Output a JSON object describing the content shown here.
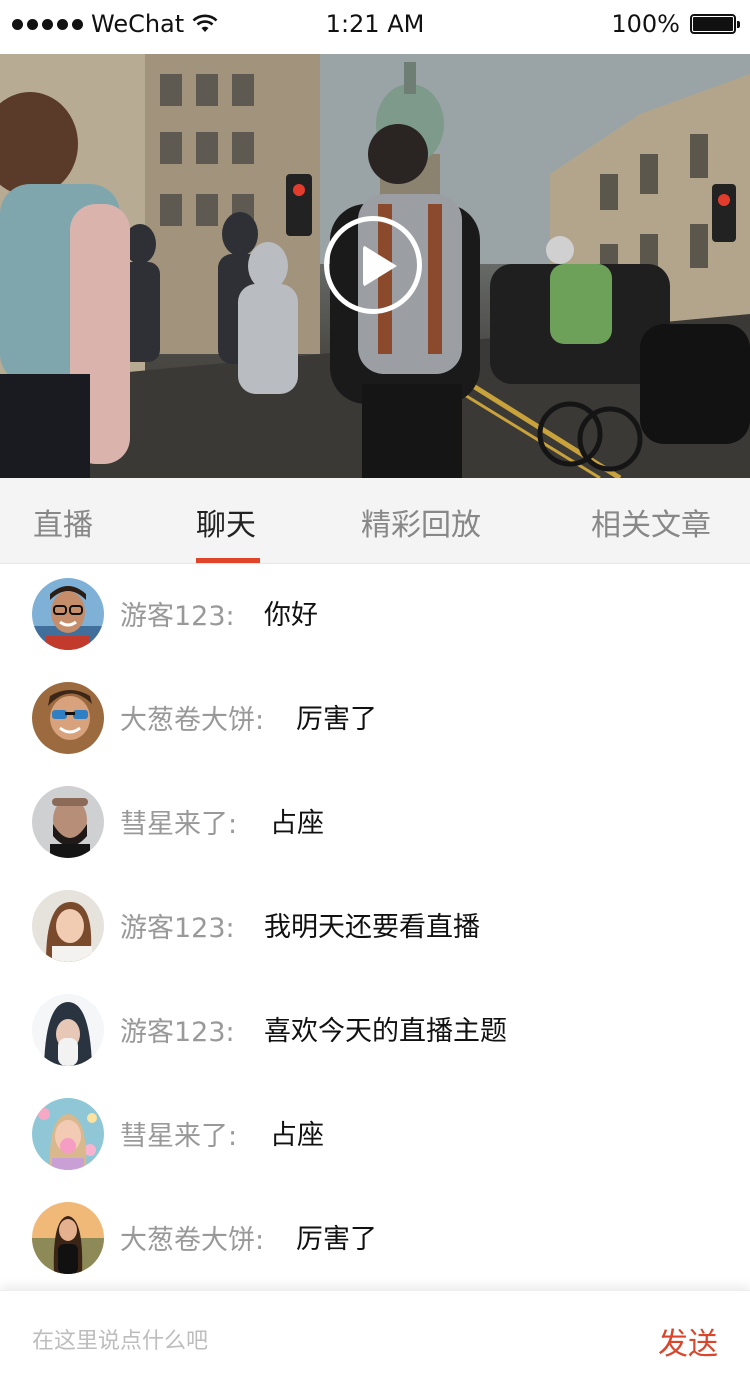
{
  "status_bar": {
    "carrier": "WeChat",
    "time": "1:21 AM",
    "battery": "100%"
  },
  "video": {
    "play_icon": "play-icon"
  },
  "tabs": [
    {
      "label": "直播",
      "active": false
    },
    {
      "label": "聊天",
      "active": true
    },
    {
      "label": "精彩回放",
      "active": false
    },
    {
      "label": "相关文章",
      "active": false
    }
  ],
  "accent_color": "#e0452a",
  "chat": [
    {
      "name": "游客123:",
      "message": "你好"
    },
    {
      "name": "大葱卷大饼:",
      "message": "厉害了"
    },
    {
      "name": "彗星来了:",
      "message": "占座"
    },
    {
      "name": "游客123:",
      "message": "我明天还要看直播"
    },
    {
      "name": "游客123:",
      "message": "喜欢今天的直播主题"
    },
    {
      "name": "彗星来了:",
      "message": "占座"
    },
    {
      "name": "大葱卷大饼:",
      "message": "厉害了"
    }
  ],
  "input_bar": {
    "placeholder": "在这里说点什么吧",
    "send_label": "发送"
  }
}
